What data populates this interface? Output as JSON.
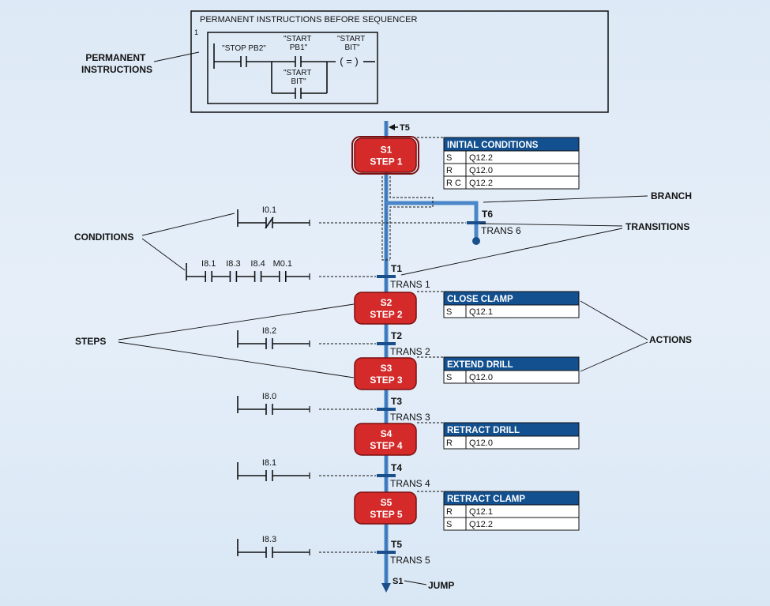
{
  "permanent": {
    "title": "PERMANENT INSTRUCTIONS BEFORE SEQUENCER",
    "network_number": "1",
    "contacts": [
      "\"STOP PB2\"",
      "\"START PB1\"",
      "\"START BIT\""
    ],
    "coil_label": "\"START BIT\"",
    "coil_symbol": "( = )"
  },
  "callouts": {
    "permanent": "PERMANENT INSTRUCTIONS",
    "conditions": "CONDITIONS",
    "steps": "STEPS",
    "branch": "BRANCH",
    "transitions": "TRANSITIONS",
    "actions": "ACTIONS",
    "jump": "JUMP"
  },
  "entry_label": "T5",
  "jump_target": "S1",
  "steps": [
    {
      "id": "S1",
      "name": "STEP 1",
      "initial": true,
      "action_title": "INITIAL CONDITIONS",
      "actions": [
        [
          "S",
          "Q12.2"
        ],
        [
          "R",
          "Q12.0"
        ],
        [
          "R C",
          "Q12.2"
        ]
      ]
    },
    {
      "id": "S2",
      "name": "STEP 2",
      "action_title": "CLOSE CLAMP",
      "actions": [
        [
          "S",
          "Q12.1"
        ]
      ]
    },
    {
      "id": "S3",
      "name": "STEP 3",
      "action_title": "EXTEND DRILL",
      "actions": [
        [
          "S",
          "Q12.0"
        ]
      ]
    },
    {
      "id": "S4",
      "name": "STEP 4",
      "action_title": "RETRACT DRILL",
      "actions": [
        [
          "R",
          "Q12.0"
        ]
      ]
    },
    {
      "id": "S5",
      "name": "STEP 5",
      "action_title": "RETRACT CLAMP",
      "actions": [
        [
          "R",
          "Q12.1"
        ],
        [
          "S",
          "Q12.2"
        ]
      ]
    }
  ],
  "transitions": [
    {
      "id": "T1",
      "name": "TRANS 1",
      "contacts": [
        {
          "label": "I8.1",
          "type": "NO"
        },
        {
          "label": "I8.3",
          "type": "NO"
        },
        {
          "label": "I8.4",
          "type": "NO"
        },
        {
          "label": "M0.1",
          "type": "NO"
        }
      ]
    },
    {
      "id": "T2",
      "name": "TRANS 2",
      "contacts": [
        {
          "label": "I8.2",
          "type": "NO"
        }
      ]
    },
    {
      "id": "T3",
      "name": "TRANS 3",
      "contacts": [
        {
          "label": "I8.0",
          "type": "NO"
        }
      ]
    },
    {
      "id": "T4",
      "name": "TRANS 4",
      "contacts": [
        {
          "label": "I8.1",
          "type": "NO"
        }
      ]
    },
    {
      "id": "T5",
      "name": "TRANS 5",
      "contacts": [
        {
          "label": "I8.3",
          "type": "NO"
        }
      ]
    }
  ],
  "branch_transition": {
    "id": "T6",
    "name": "TRANS 6",
    "contacts": [
      {
        "label": "I0.1",
        "type": "NC"
      }
    ]
  },
  "colors": {
    "step": "#d42a2a",
    "step_border": "#7a1010",
    "flow_line": "#4a86c8",
    "transition_bar": "#1b4f8c",
    "table_header": "#12508f",
    "background": "#dde9f6"
  }
}
